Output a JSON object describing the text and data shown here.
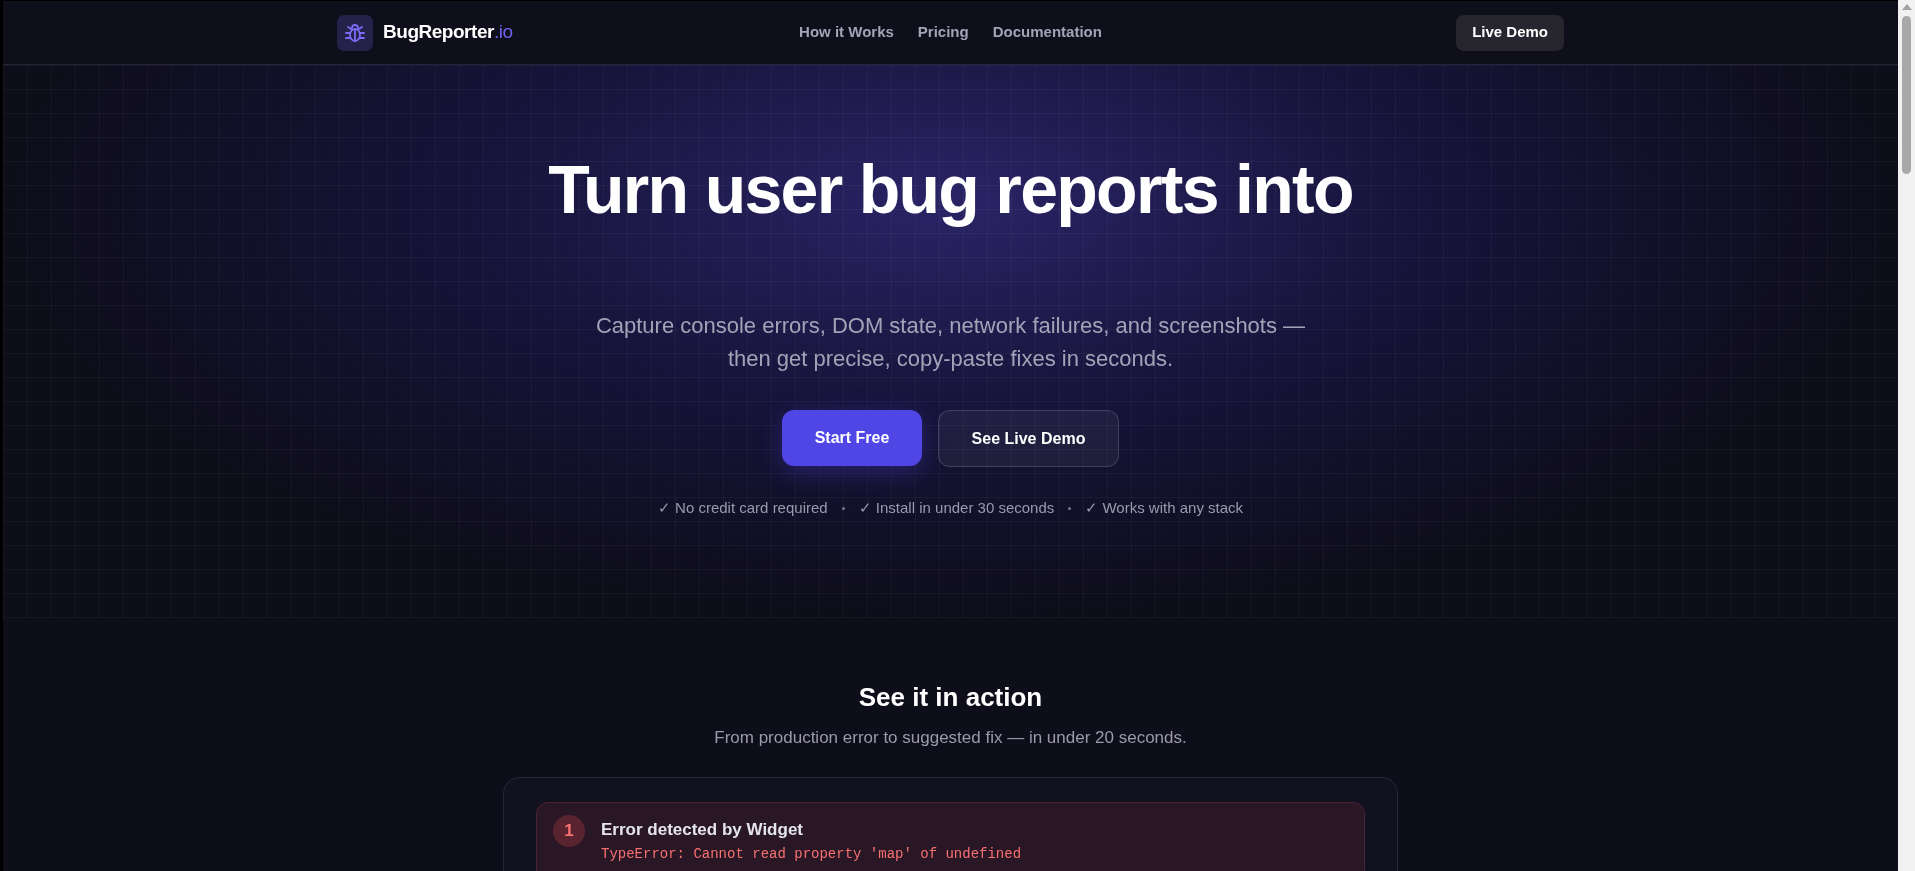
{
  "header": {
    "logo": {
      "name": "BugReporter",
      "suffix": ".io"
    },
    "nav": [
      "How it Works",
      "Pricing",
      "Documentation"
    ],
    "cta": "Live Demo"
  },
  "hero": {
    "title": "Turn user bug reports into",
    "subtitle": "Capture console errors, DOM state, network failures, and screenshots — then get precise, copy-paste fixes in seconds.",
    "buttons": [
      {
        "label": "Start Free",
        "kind": "primary"
      },
      {
        "label": "See Live Demo",
        "kind": "secondary"
      }
    ],
    "perks": [
      "✓ No credit card required",
      "✓ Install in under 30 seconds",
      "✓ Works with any stack"
    ]
  },
  "demo": {
    "title": "See it in action",
    "subtitle": "From production error to suggested fix — in under 20 seconds.",
    "steps": [
      {
        "number": "1",
        "title": "Error detected by Widget",
        "code": "TypeError: Cannot read property 'map' of undefined"
      }
    ]
  }
}
